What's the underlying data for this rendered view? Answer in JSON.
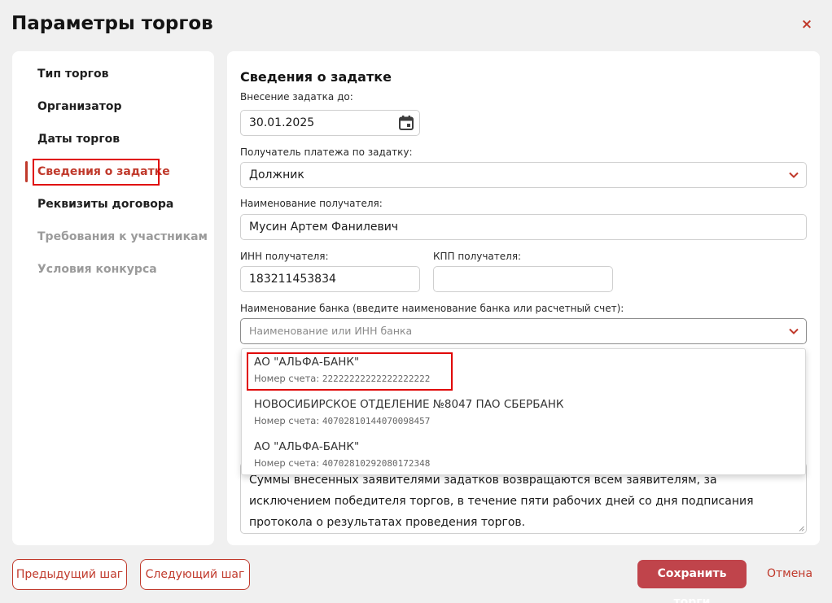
{
  "dialog": {
    "title": "Параметры торгов",
    "close_label": "×"
  },
  "sidebar": {
    "items": [
      {
        "label": "Тип торгов"
      },
      {
        "label": "Организатор"
      },
      {
        "label": "Даты торгов"
      },
      {
        "label": "Сведения о задатке"
      },
      {
        "label": "Реквизиты договора"
      },
      {
        "label": "Требования к участникам"
      },
      {
        "label": "Условия конкурса"
      }
    ]
  },
  "form": {
    "section_title": "Сведения о задатке",
    "deposit_deadline": {
      "label": "Внесение задатка до:",
      "value": "30.01.2025"
    },
    "payee": {
      "label": "Получатель платежа по задатку:",
      "value": "Должник"
    },
    "recipient_name": {
      "label": "Наименование получателя:",
      "value": "Мусин Артем Фанилевич"
    },
    "inn": {
      "label": "ИНН получателя:",
      "value": "183211453834"
    },
    "kpp": {
      "label": "КПП получателя:",
      "value": ""
    },
    "bank": {
      "label": "Наименование банка (введите наименование банка или расчетный счет):",
      "placeholder": "Наименование или ИНН банка"
    },
    "notes": "Суммы внесенных заявителями задатков возвращаются всем заявителям, за исключением победителя торгов, в течение пяти рабочих дней со дня подписания протокола о результатах проведения торгов."
  },
  "bank_options": [
    {
      "name": "АО \"АЛЬФА-БАНК\"",
      "account_label": "Номер счета:",
      "account": "22222222222222222222"
    },
    {
      "name": "НОВОСИБИРСКОЕ ОТДЕЛЕНИЕ №8047 ПАО СБЕРБАНК",
      "account_label": "Номер счета:",
      "account": "40702810144070098457"
    },
    {
      "name": "АО \"АЛЬФА-БАНК\"",
      "account_label": "Номер счета:",
      "account": "40702810292080172348"
    }
  ],
  "footer": {
    "prev_label": "Предыдущий шаг",
    "next_label": "Следующий шаг",
    "save_label": "Сохранить торги",
    "cancel_label": "Отмена"
  },
  "colors": {
    "accent": "#c0392b",
    "primary_button": "#c0444b",
    "highlight_box": "#e00000"
  }
}
